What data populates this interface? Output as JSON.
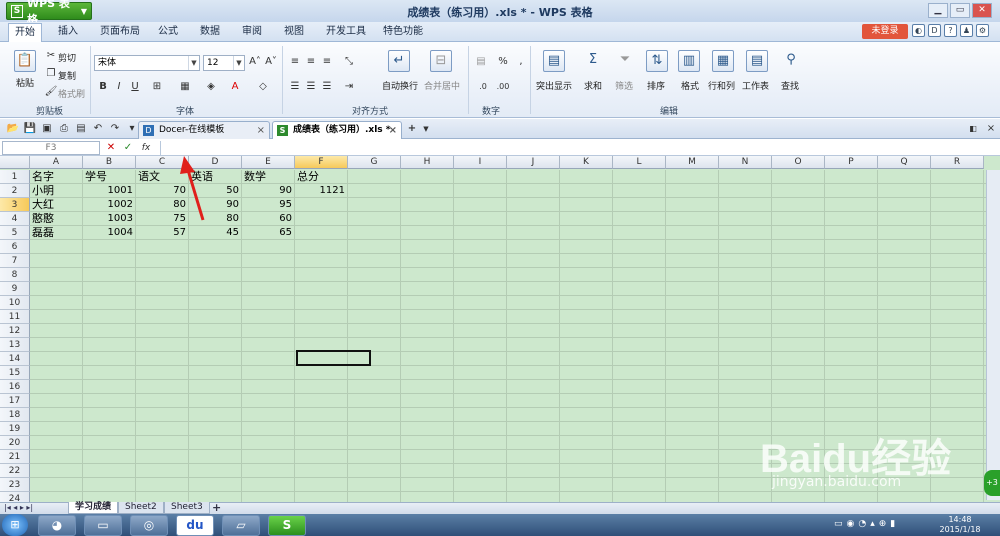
{
  "app": {
    "name": "WPS 表格",
    "logo": "S",
    "window_title": "成绩表（练习用）.xls * - WPS 表格"
  },
  "menus": [
    "开始",
    "插入",
    "页面布局",
    "公式",
    "数据",
    "审阅",
    "视图",
    "开发工具",
    "特色功能"
  ],
  "login_label": "未登录",
  "ribbon": {
    "clipboard": {
      "paste": "粘贴",
      "cut": "剪切",
      "copy": "复制",
      "format_painter": "格式刷",
      "group": "剪贴板"
    },
    "font": {
      "name": "宋体",
      "size": "12",
      "bold": "B",
      "italic": "I",
      "underline": "U",
      "group": "字体"
    },
    "align": {
      "wrap": "自动换行",
      "merge": "合并居中",
      "group": "对齐方式"
    },
    "number": {
      "percent": "%",
      "group": "数字"
    },
    "edit": {
      "highlight": "突出显示",
      "sum": "求和",
      "filter": "筛选",
      "sort": "排序",
      "format": "格式",
      "rowcol": "行和列",
      "sheet": "工作表",
      "find": "查找",
      "group": "编辑"
    }
  },
  "doc_tabs": [
    {
      "label": "Docer-在线模板"
    },
    {
      "label": "成绩表（练习用）.xls *"
    }
  ],
  "formula": {
    "name_box": "F3",
    "cancel": "✕",
    "confirm": "✓",
    "fx": "fx",
    "value": ""
  },
  "columns": [
    "A",
    "B",
    "C",
    "D",
    "E",
    "F",
    "G",
    "H",
    "I",
    "J",
    "K",
    "L",
    "M",
    "N",
    "O",
    "P",
    "Q",
    "R"
  ],
  "rows": [
    "1",
    "2",
    "3",
    "4",
    "5",
    "6",
    "7",
    "8",
    "9",
    "10",
    "11",
    "12",
    "13",
    "14",
    "15",
    "16",
    "17",
    "18",
    "19",
    "20",
    "21",
    "22",
    "23",
    "24"
  ],
  "table": {
    "headers": [
      "名字",
      "学号",
      "语文",
      "英语",
      "数学",
      "总分"
    ],
    "data": [
      [
        "小明",
        "1001",
        "70",
        "50",
        "90",
        "1121"
      ],
      [
        "大红",
        "1002",
        "80",
        "90",
        "95",
        ""
      ],
      [
        "憨憨",
        "1003",
        "75",
        "80",
        "60",
        ""
      ],
      [
        "磊磊",
        "1004",
        "57",
        "45",
        "65",
        ""
      ]
    ]
  },
  "sheets": [
    "学习成绩",
    "Sheet2",
    "Sheet3"
  ],
  "clock": {
    "time": "14:48",
    "date": "2015/1/18"
  },
  "watermark": {
    "text": "Baidu经验",
    "url": "jingyan.baidu.com"
  }
}
